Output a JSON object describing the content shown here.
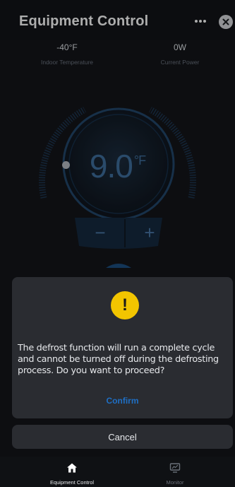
{
  "header": {
    "title": "Equipment Control",
    "more_icon": "more-horizontal-icon",
    "close_icon": "close-icon"
  },
  "stats": {
    "indoor_temperature": {
      "value": "-40°F",
      "label": "Indoor Temperature"
    },
    "current_power": {
      "value": "0W",
      "label": "Current Power"
    }
  },
  "dial": {
    "setpoint": "9.0",
    "unit": "°F",
    "minus_label": "−",
    "plus_label": "+"
  },
  "dialog": {
    "icon": "warning-icon",
    "icon_glyph": "!",
    "message": "The defrost function will run a complete cycle and cannot be turned off during the defrosting process. Do you want to proceed?",
    "confirm_label": "Confirm",
    "cancel_label": "Cancel"
  },
  "bottom_nav": {
    "items": [
      {
        "label": "Equipment Control",
        "icon": "home-icon",
        "active": true
      },
      {
        "label": "Monitor",
        "icon": "monitor-icon",
        "active": false
      }
    ]
  },
  "colors": {
    "warning": "#f2c500",
    "accent": "#1f6fc4",
    "dial_blue": "#3f6f9e"
  }
}
